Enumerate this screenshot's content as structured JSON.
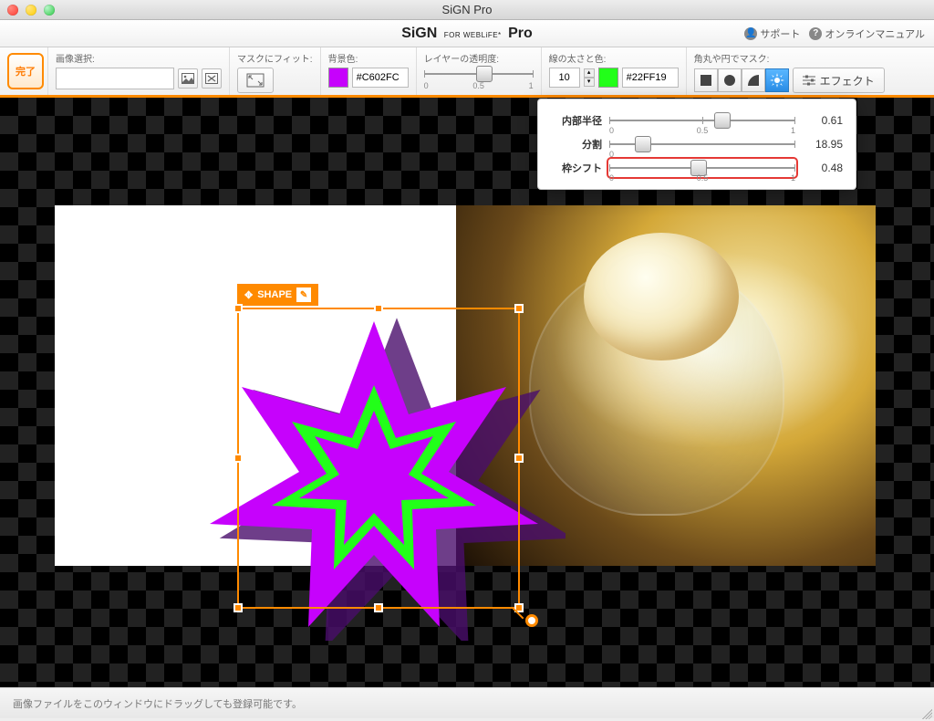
{
  "window": {
    "title": "SiGN Pro"
  },
  "header": {
    "brand_main": "SiGN",
    "brand_sub": "FOR WEBLiFE*",
    "brand_suffix": "Pro",
    "support": "サポート",
    "manual": "オンラインマニュアル"
  },
  "toolbar": {
    "done": "完了",
    "image_select_label": "画像選択:",
    "fit_label": "マスクにフィット:",
    "bg_label": "背景色:",
    "bg_hex": "#C602FC",
    "opacity_label": "レイヤーの透明度:",
    "opacity_min": "0",
    "opacity_mid": "0.5",
    "opacity_max": "1",
    "stroke_label": "線の太さと色:",
    "stroke_width": "10",
    "stroke_hex": "#22FF19",
    "mask_label": "角丸や円でマスク:",
    "effect": "エフェクト"
  },
  "selection": {
    "label": "SHAPE"
  },
  "popover": {
    "rows": [
      {
        "label": "内部半径",
        "min": "0",
        "mid": "0.5",
        "max": "1",
        "value": "0.61",
        "pos": 61,
        "highlight": false
      },
      {
        "label": "分割",
        "min": "0",
        "mid": "",
        "max": "",
        "value": "18.95",
        "pos": 18,
        "highlight": false
      },
      {
        "label": "枠シフト",
        "min": "0",
        "mid": "0.5",
        "max": "1",
        "value": "0.48",
        "pos": 48,
        "highlight": true
      }
    ]
  },
  "statusbar": {
    "hint": "画像ファイルをこのウィンドウにドラッグしても登録可能です。"
  },
  "colors": {
    "accent": "#ff8a00",
    "shape_fill": "#C602FC",
    "shape_stroke": "#22FF19"
  }
}
